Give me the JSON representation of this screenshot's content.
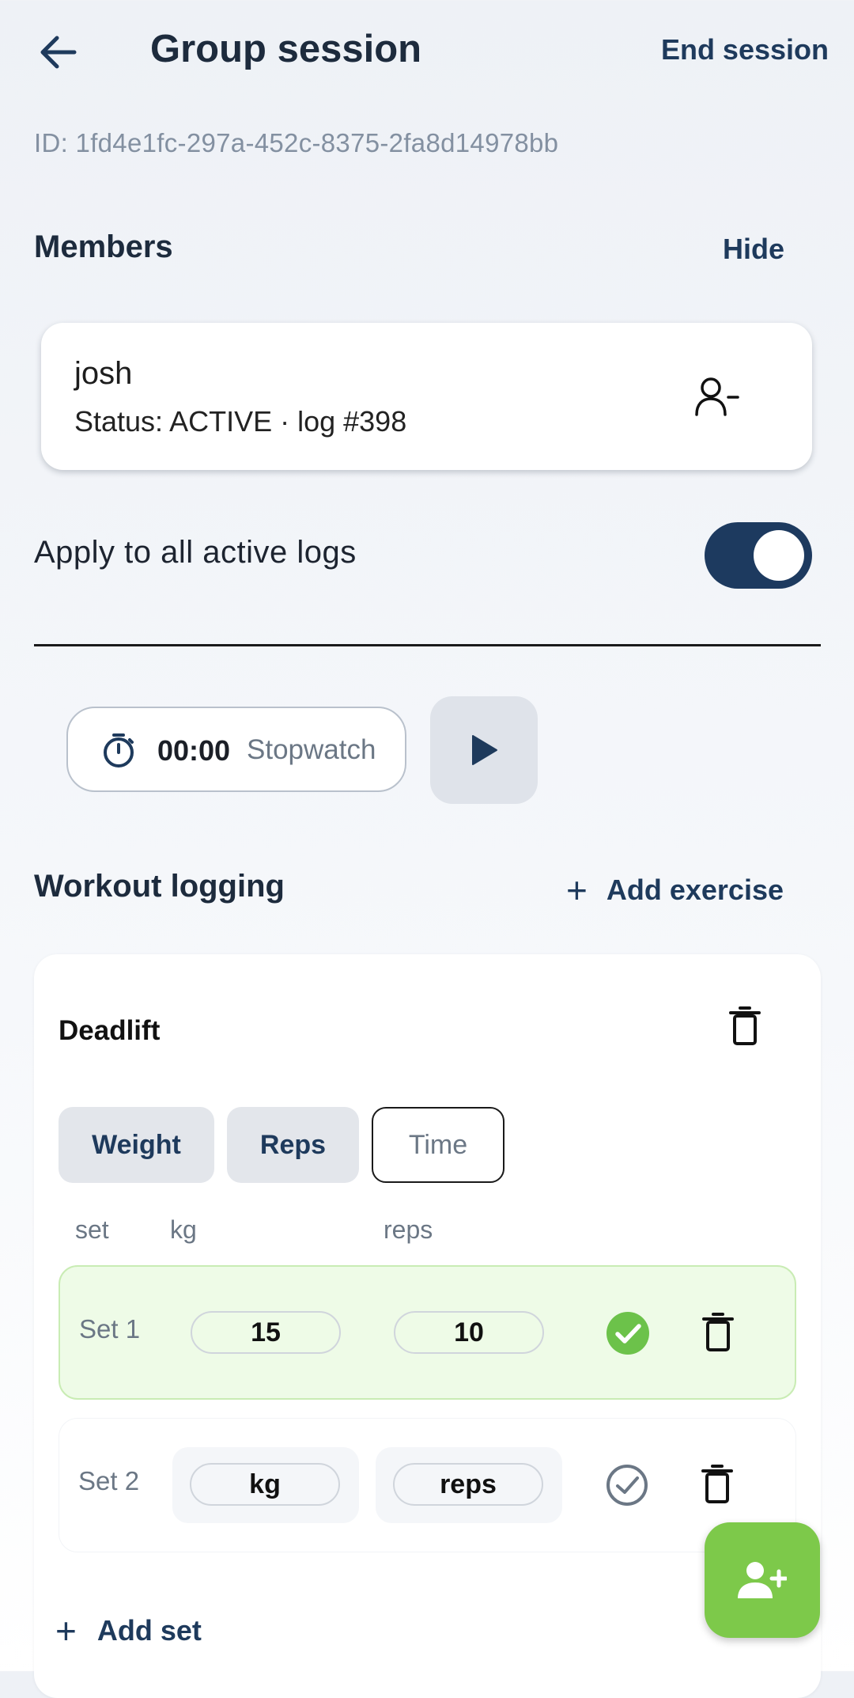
{
  "header": {
    "title": "Group session",
    "back_icon": "arrow-left-icon",
    "end_label": "End session"
  },
  "session_id": "ID: 1fd4e1fc-297a-452c-8375-2fa8d14978bb",
  "members": {
    "heading": "Members",
    "hide_label": "Hide",
    "list": [
      {
        "name": "josh",
        "status": "Status: ACTIVE · log #398",
        "action_icon": "user-minus-icon"
      }
    ]
  },
  "apply_all": {
    "label": "Apply to all active logs",
    "enabled": true
  },
  "stopwatch": {
    "time": "00:00",
    "label": "Stopwatch",
    "icon": "stopwatch-icon",
    "play_icon": "play-icon"
  },
  "workout": {
    "heading": "Workout logging",
    "add_exercise_label": "Add exercise",
    "exercise": {
      "name": "Deadlift",
      "modes": [
        {
          "label": "Weight",
          "active": true
        },
        {
          "label": "Reps",
          "active": true
        },
        {
          "label": "Time",
          "active": false
        }
      ],
      "columns": {
        "set": "set",
        "kg": "kg",
        "reps": "reps"
      },
      "sets": [
        {
          "label": "Set 1",
          "kg": "15",
          "reps": "10",
          "completed": true
        },
        {
          "label": "Set 2",
          "kg": "kg",
          "reps": "reps",
          "completed": false
        }
      ],
      "add_set_label": "Add set"
    }
  },
  "fab_icon": "add-user-icon",
  "colors": {
    "primary": "#1d3a5f",
    "success": "#6cc24a",
    "fab": "#7dc94a"
  }
}
